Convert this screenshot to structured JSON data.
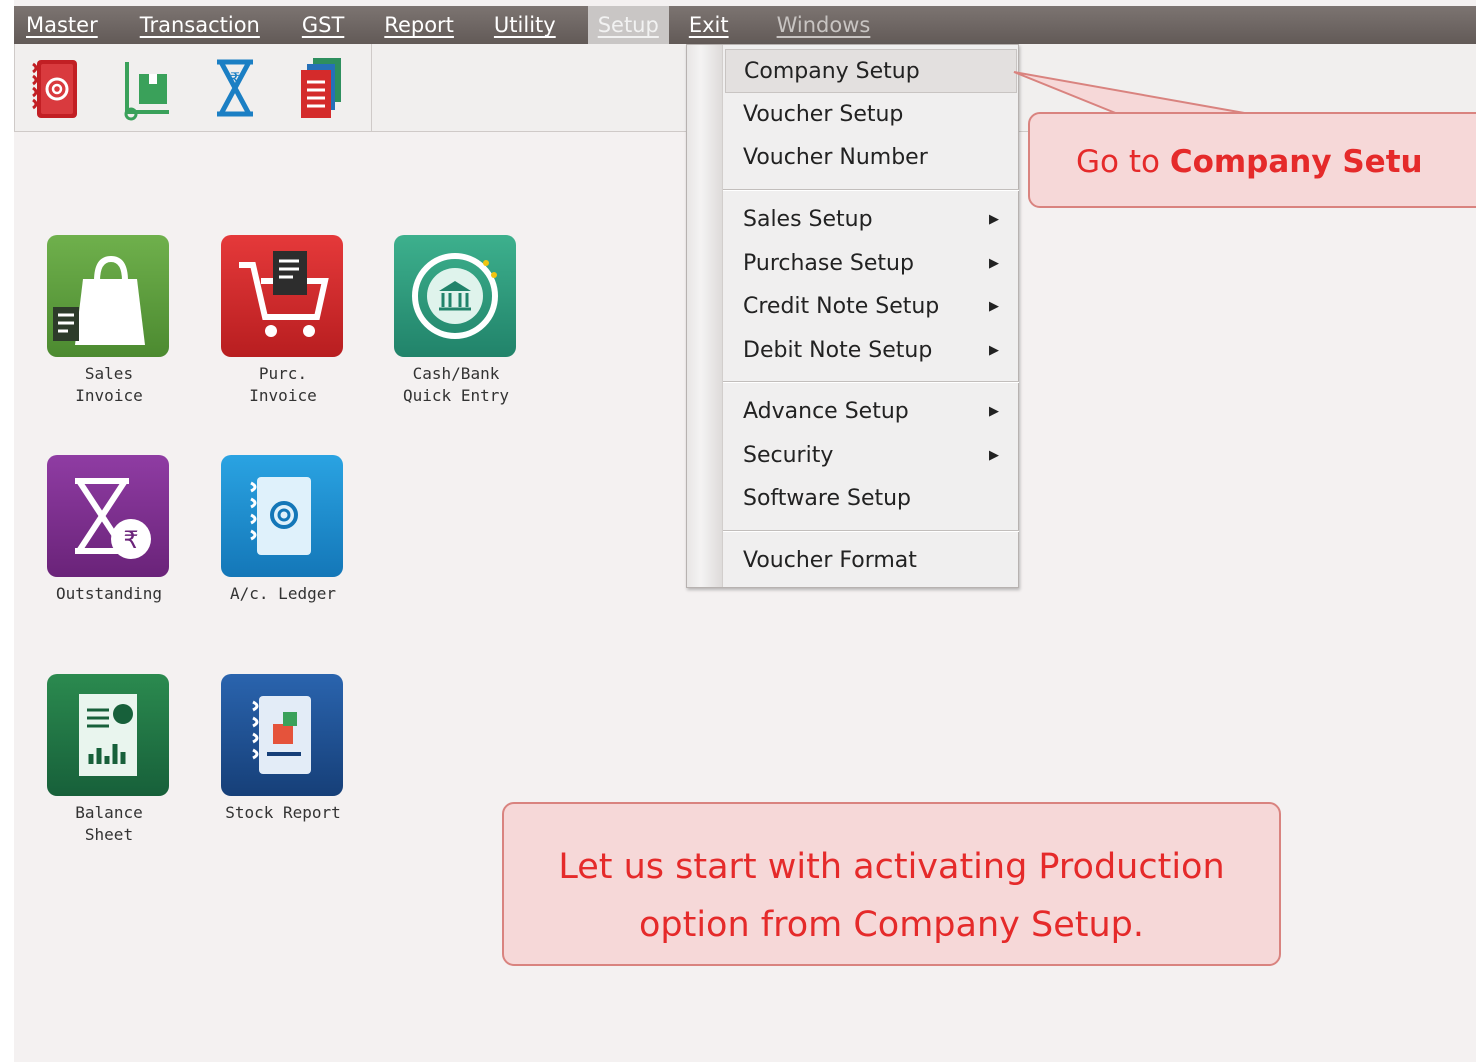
{
  "menubar": {
    "items": [
      "Master",
      "Transaction",
      "GST",
      "Report",
      "Utility",
      "Setup",
      "Exit",
      "Windows"
    ],
    "active": "Setup"
  },
  "toolbar": {
    "buttons": [
      "ledger-book-icon",
      "stock-trolley-icon",
      "outstanding-hourglass-icon",
      "report-pages-icon"
    ]
  },
  "tiles": [
    {
      "label": "Sales\nInvoice",
      "icon": "shopping-bag-icon",
      "color": "#5b9a3c"
    },
    {
      "label": "Purc. Invoice",
      "icon": "shopping-cart-icon",
      "color": "#d42b2b"
    },
    {
      "label": "Cash/Bank\nQuick Entry",
      "icon": "bank-icon",
      "color": "#2f9e7e"
    },
    {
      "label": "Outstanding",
      "icon": "hourglass-rupee-icon",
      "color": "#7c2f8f"
    },
    {
      "label": "A/c. Ledger",
      "icon": "address-book-icon",
      "color": "#1d8fd0"
    },
    {
      "label": "Balance\nSheet",
      "icon": "balance-sheet-icon",
      "color": "#1f6e3c"
    },
    {
      "label": "Stock Report",
      "icon": "stock-report-icon",
      "color": "#1d4f8f"
    }
  ],
  "setup_menu": {
    "items": [
      {
        "label": "Company Setup",
        "submenu": false
      },
      {
        "label": "Voucher Setup",
        "submenu": false
      },
      {
        "label": "Voucher Number",
        "submenu": false
      },
      {
        "label": "Sales Setup",
        "submenu": true
      },
      {
        "label": "Purchase Setup",
        "submenu": true
      },
      {
        "label": "Credit Note Setup",
        "submenu": true
      },
      {
        "label": "Debit Note Setup",
        "submenu": true
      },
      {
        "label": "Advance Setup",
        "submenu": true
      },
      {
        "label": "Security",
        "submenu": true
      },
      {
        "label": "Software Setup",
        "submenu": false
      },
      {
        "label": "Voucher Format",
        "submenu": false
      }
    ],
    "highlighted": "Company Setup"
  },
  "callouts": {
    "top_prefix": "Go to ",
    "top_bold": "Company Setu",
    "bottom": "Let us start with activating Production option from Company Setup."
  },
  "colors": {
    "callout_text": "#e52a2a",
    "callout_bg": "#f6d8d8"
  }
}
